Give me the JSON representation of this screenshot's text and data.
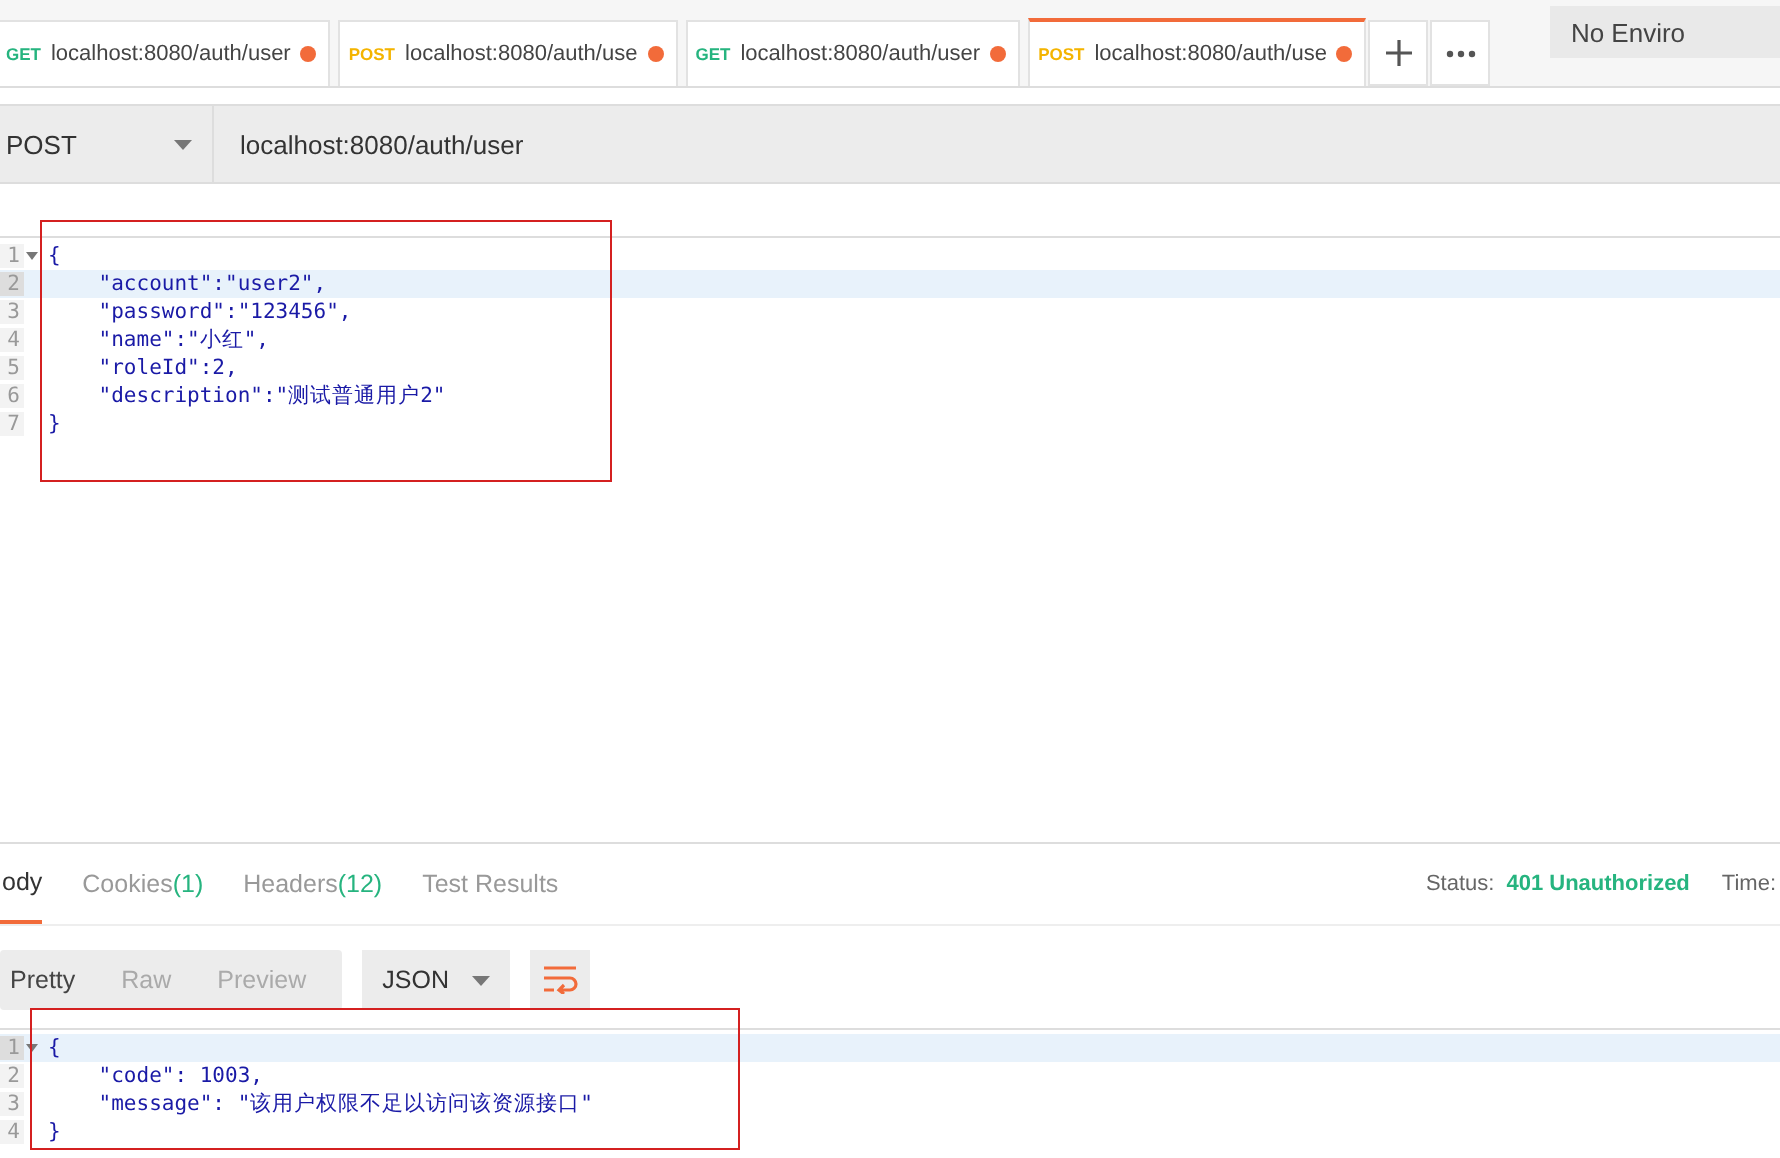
{
  "tabs": [
    {
      "method": "GET",
      "url": "localhost:8080/auth/user",
      "selected": false,
      "unsaved": true
    },
    {
      "method": "POST",
      "url": "localhost:8080/auth/use",
      "selected": false,
      "unsaved": true
    },
    {
      "method": "GET",
      "url": "localhost:8080/auth/user",
      "selected": false,
      "unsaved": true
    },
    {
      "method": "POST",
      "url": "localhost:8080/auth/use",
      "selected": true,
      "unsaved": true
    }
  ],
  "environment": "No Enviro",
  "request": {
    "method": "POST",
    "url": "localhost:8080/auth/user"
  },
  "request_body": {
    "lines": [
      {
        "number": "1",
        "text": "{",
        "current": false,
        "foldable": true
      },
      {
        "number": "2",
        "text": "    \"account\":\"user2\",",
        "current": true,
        "foldable": false
      },
      {
        "number": "3",
        "text": "    \"password\":\"123456\",",
        "current": false,
        "foldable": false
      },
      {
        "number": "4",
        "text": "    \"name\":\"小红\",",
        "current": false,
        "foldable": false
      },
      {
        "number": "5",
        "text": "    \"roleId\":2,",
        "current": false,
        "foldable": false
      },
      {
        "number": "6",
        "text": "    \"description\":\"测试普通用户2\"",
        "current": false,
        "foldable": false
      },
      {
        "number": "7",
        "text": "}",
        "current": false,
        "foldable": false
      }
    ]
  },
  "response_tabs": [
    {
      "label": "ody",
      "selected": true
    },
    {
      "label": "Cookies",
      "count": "(1)",
      "selected": false
    },
    {
      "label": "Headers",
      "count": "(12)",
      "selected": false
    },
    {
      "label": "Test Results",
      "selected": false
    }
  ],
  "status": {
    "label": "Status:",
    "value": "401 Unauthorized",
    "time_label": "Time:"
  },
  "view_modes": [
    {
      "label": "Pretty",
      "selected": true
    },
    {
      "label": "Raw",
      "selected": false
    },
    {
      "label": "Preview",
      "selected": false
    }
  ],
  "format": "JSON",
  "response_body": {
    "lines": [
      {
        "number": "1",
        "text": "{",
        "current": true,
        "foldable": true
      },
      {
        "number": "2",
        "text": "    \"code\": 1003,",
        "current": false,
        "foldable": false
      },
      {
        "number": "3",
        "text": "    \"message\": \"该用户权限不足以访问该资源接口\"",
        "current": false,
        "foldable": false
      },
      {
        "number": "4",
        "text": "}",
        "current": false,
        "foldable": false
      }
    ]
  }
}
